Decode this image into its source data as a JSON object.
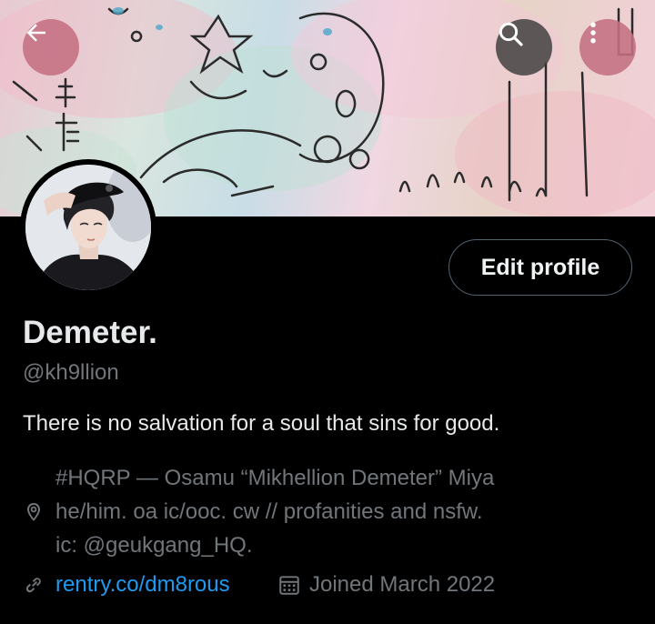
{
  "profile": {
    "display_name": "Demeter.",
    "handle": "@kh9llion",
    "bio": "There is no salvation for a soul that sins for good.",
    "location_lines": [
      "#HQRP — Osamu “Mikhellion Demeter” Miya",
      "he/him. oa ic/ooc. cw // profanities and nsfw.",
      "ic: @geukgang_HQ."
    ],
    "website": "rentry.co/dm8rous",
    "joined": "Joined March 2022"
  },
  "actions": {
    "edit_profile_label": "Edit profile"
  },
  "icons": {
    "back": "arrow-left-icon",
    "search": "search-icon",
    "more": "more-vertical-icon",
    "location": "location-pin-icon",
    "link": "link-icon",
    "calendar": "calendar-icon"
  },
  "colors": {
    "background": "#000000",
    "text_primary": "#e7e9ea",
    "text_secondary": "#71767b",
    "link": "#1d9bf0",
    "button_border": "#536471"
  }
}
